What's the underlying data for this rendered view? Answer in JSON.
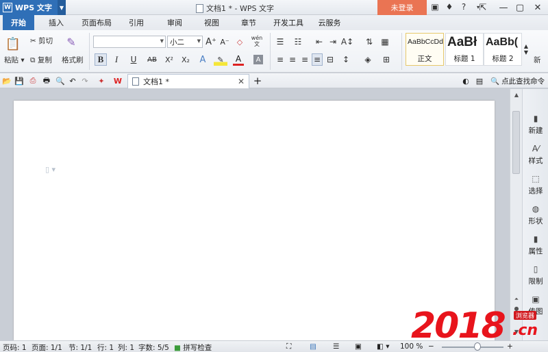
{
  "app": {
    "menu_label": "WPS 文字",
    "window_title": "文档1 * - WPS 文字",
    "login_label": "未登录"
  },
  "tabs": [
    {
      "label": "开始",
      "active": true
    },
    {
      "label": "插入"
    },
    {
      "label": "页面布局"
    },
    {
      "label": "引用"
    },
    {
      "label": "审阅"
    },
    {
      "label": "视图"
    },
    {
      "label": "章节"
    },
    {
      "label": "开发工具"
    },
    {
      "label": "云服务"
    }
  ],
  "ribbon": {
    "paste_label": "粘贴",
    "cut_label": "剪切",
    "copy_label": "复制",
    "format_painter_label": "格式刷",
    "font_name_value": "",
    "font_size_value": "小二",
    "bold": "B",
    "italic": "I",
    "underline": "U",
    "strike": "AB",
    "superscript": "X²",
    "subscript": "X₂",
    "wen": "wén",
    "styles": [
      {
        "sample": "AaBbCcDd",
        "name": "正文"
      },
      {
        "sample": "AaBł",
        "name": "标题 1"
      },
      {
        "sample": "AaBb(",
        "name": "标题 2"
      }
    ],
    "new_style_label": "新"
  },
  "document_tab": {
    "name": "文档1 *"
  },
  "command_search_label": "点此查找命令",
  "side_panel": [
    {
      "label": "新建",
      "icon": "new-doc-icon"
    },
    {
      "label": "样式",
      "icon": "style-icon"
    },
    {
      "label": "选择",
      "icon": "select-icon"
    },
    {
      "label": "形状",
      "icon": "shape-icon"
    },
    {
      "label": "属性",
      "icon": "property-icon"
    },
    {
      "label": "限制",
      "icon": "restrict-icon"
    },
    {
      "label": "传图",
      "icon": "upload-image-icon"
    }
  ],
  "status": {
    "page_code": "页码: 1",
    "page": "页面: 1/1",
    "section": "节: 1/1",
    "line": "行: 1",
    "column": "列: 1",
    "word_count": "字数: 5/5",
    "spell_check": "拼写检查",
    "zoom": "100 %",
    "zoom_minus": "−",
    "zoom_plus": "+"
  },
  "watermark": {
    "number": "2018",
    "badge": "浏览器",
    "domain": ".cn"
  },
  "colors": {
    "accent": "#2f6fb7",
    "login": "#ea7453",
    "watermark": "#e8141c"
  }
}
